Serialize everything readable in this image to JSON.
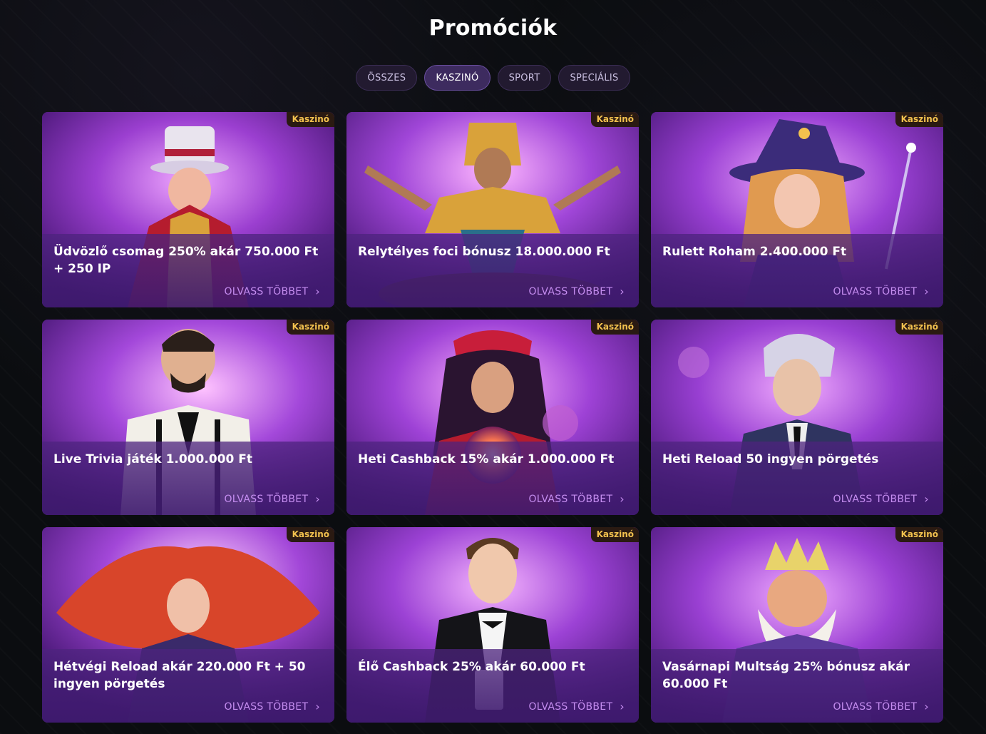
{
  "page_title": "Promóciók",
  "filters": [
    {
      "label": "ÖSSZES",
      "active": false
    },
    {
      "label": "KASZINÓ",
      "active": true
    },
    {
      "label": "SPORT",
      "active": false
    },
    {
      "label": "SPECIÁLIS",
      "active": false
    }
  ],
  "read_more_label": "OLVASS TÖBBET",
  "cards": [
    {
      "badge": "Kaszinó",
      "title": "Üdvözlő csomag 250% akár 750.000 Ft + 250 IP",
      "read_more": "OLVASS TÖBBET",
      "art": "magician-character"
    },
    {
      "badge": "Kaszinó",
      "title": "Relytélyes foci bónusz 18.000.000 Ft",
      "read_more": "OLVASS TÖBBET",
      "art": "egyptian-queen-character"
    },
    {
      "badge": "Kaszinó",
      "title": "Rulett Roham 2.400.000 Ft",
      "read_more": "OLVASS TÖBBET",
      "art": "witch-character"
    },
    {
      "badge": "Kaszinó",
      "title": "Live Trivia játék 1.000.000 Ft",
      "read_more": "OLVASS TÖBBET",
      "art": "live-dealer-character"
    },
    {
      "badge": "Kaszinó",
      "title": "Heti Cashback 15% akár 1.000.000 Ft",
      "read_more": "OLVASS TÖBBET",
      "art": "fortune-teller-character"
    },
    {
      "badge": "Kaszinó",
      "title": "Heti Reload 50 ingyen pörgetés",
      "read_more": "OLVASS TÖBBET",
      "art": "boy-in-suit-character"
    },
    {
      "badge": "Kaszinó",
      "title": "Hétvégi Reload akár 220.000 Ft + 50 ingyen pörgetés",
      "read_more": "OLVASS TÖBBET",
      "art": "red-haired-woman-character"
    },
    {
      "badge": "Kaszinó",
      "title": "Élő Cashback 25% akár 60.000 Ft",
      "read_more": "OLVASS TÖBBET",
      "art": "croupier-character"
    },
    {
      "badge": "Kaszinó",
      "title": "Vasárnapi Multság 25% bónusz akár 60.000 Ft",
      "read_more": "OLVASS TÖBBET",
      "art": "king-character"
    }
  ],
  "colors": {
    "background": "#0b0d10",
    "accent": "#c58df0",
    "badge_text": "#f2c14e",
    "active_filter": "#3d2b5f"
  }
}
